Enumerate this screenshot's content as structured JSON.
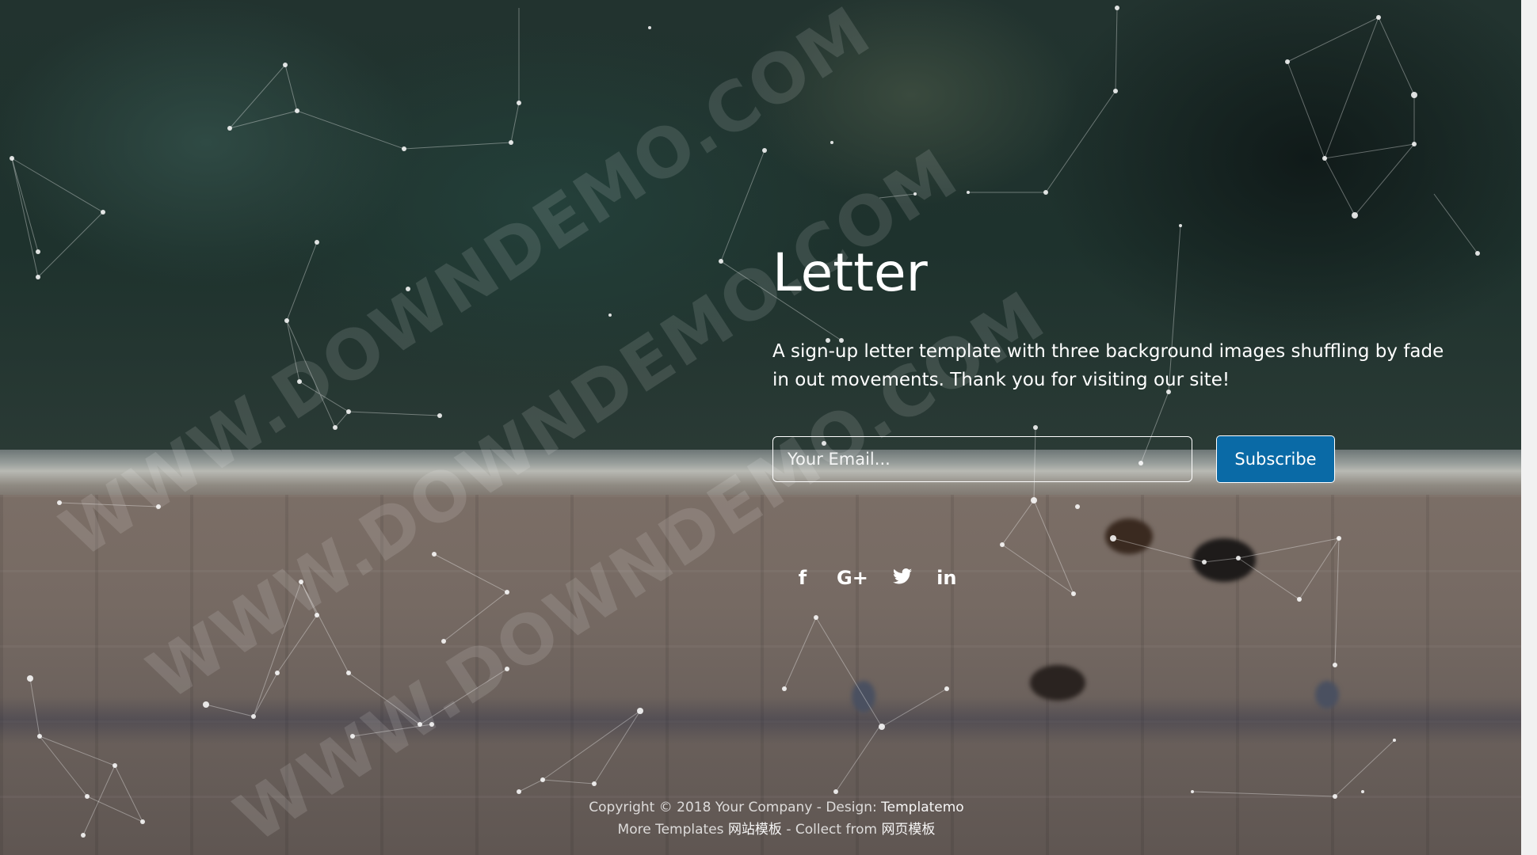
{
  "hero": {
    "title": "Letter",
    "description": "A sign-up letter template with three background images shuffling by fade in out movements. Thank you for visiting our site!"
  },
  "form": {
    "email_placeholder": "Your Email...",
    "email_value": "",
    "subscribe_label": "Subscribe"
  },
  "social": {
    "items": [
      {
        "icon": "facebook-icon",
        "glyph": "f"
      },
      {
        "icon": "google-plus-icon",
        "glyph": "G+"
      },
      {
        "icon": "twitter-icon",
        "glyph": "🐦"
      },
      {
        "icon": "linkedin-icon",
        "glyph": "in"
      }
    ]
  },
  "footer": {
    "copyright_text": "Copyright © 2018 Your Company - Design: ",
    "design_link": "Templatemo",
    "more_text": "More Templates ",
    "more_link": "网站模板",
    "collect_text": " - Collect from ",
    "collect_link": "网页模板"
  },
  "watermark": {
    "text": "WWW.DOWNDEMO.COM"
  },
  "colors": {
    "accent": "#0a6aa6",
    "text": "#ffffff"
  }
}
